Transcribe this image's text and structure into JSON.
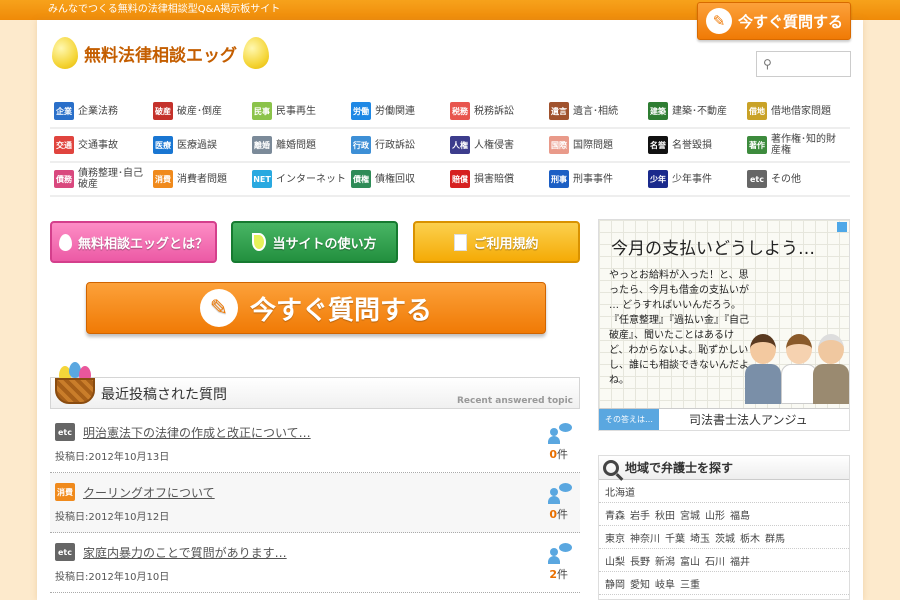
{
  "tagline": "みんなでつくる無料の法律相談型Q&A掲示板サイト",
  "header_button": "今すぐ質問する",
  "logo_text": "無料法律相談エッグ",
  "search": {
    "placeholder": ""
  },
  "categories": [
    [
      {
        "badge": "企業",
        "label": "企業法務",
        "color": "#2a6fc9"
      },
      {
        "badge": "破産",
        "label": "破産･倒産",
        "color": "#c4312b"
      },
      {
        "badge": "民事",
        "label": "民事再生",
        "color": "#8bc34a"
      },
      {
        "badge": "労働",
        "label": "労働関連",
        "color": "#1e88e5"
      },
      {
        "badge": "税務",
        "label": "税務訴訟",
        "color": "#e8554e"
      },
      {
        "badge": "遺言",
        "label": "遺言･相続",
        "color": "#a0522d"
      },
      {
        "badge": "建築",
        "label": "建築･不動産",
        "color": "#2e7d32"
      },
      {
        "badge": "借地",
        "label": "借地借家問題",
        "color": "#c9a227"
      }
    ],
    [
      {
        "badge": "交通",
        "label": "交通事故",
        "color": "#e0443e"
      },
      {
        "badge": "医療",
        "label": "医療過誤",
        "color": "#1976d2"
      },
      {
        "badge": "離婚",
        "label": "離婚問題",
        "color": "#7b8a99"
      },
      {
        "badge": "行政",
        "label": "行政訴訟",
        "color": "#3d8fd6"
      },
      {
        "badge": "人権",
        "label": "人権侵害",
        "color": "#3c3c8c"
      },
      {
        "badge": "国際",
        "label": "国際問題",
        "color": "#e99a8a"
      },
      {
        "badge": "名誉",
        "label": "名誉毀損",
        "color": "#111111"
      },
      {
        "badge": "著作",
        "label": "著作権･知的財産権",
        "color": "#3d8b3d"
      }
    ],
    [
      {
        "badge": "債務",
        "label": "債務整理･自己破産",
        "color": "#d9487e"
      },
      {
        "badge": "消費",
        "label": "消費者問題",
        "color": "#f08a1c"
      },
      {
        "badge": "NET",
        "label": "インターネット",
        "color": "#29a9e0"
      },
      {
        "badge": "債権",
        "label": "債権回収",
        "color": "#2e8b57"
      },
      {
        "badge": "賠償",
        "label": "損害賠償",
        "color": "#d62020"
      },
      {
        "badge": "刑事",
        "label": "刑事事件",
        "color": "#1c5fc4"
      },
      {
        "badge": "少年",
        "label": "少年事件",
        "color": "#1a2a8c"
      },
      {
        "badge": "etc",
        "label": "その他",
        "color": "#666666"
      }
    ]
  ],
  "nav_buttons": {
    "about": "無料相談エッグとは？",
    "howto": "当サイトの使い方",
    "terms": "ご利用規約"
  },
  "big_button": "今すぐ質問する",
  "recent": {
    "title": "最近投稿された質問",
    "subtitle": "Recent answered topic",
    "posts": [
      {
        "badge": "etc",
        "badge_color": "#666666",
        "title": "明治憲法下の法律の作成と改正について…",
        "date": "投稿日:2012年10月13日",
        "count": "0",
        "unit": "件"
      },
      {
        "badge": "消費",
        "badge_color": "#f08a1c",
        "title": "クーリングオフについて",
        "date": "投稿日:2012年10月12日",
        "count": "0",
        "unit": "件"
      },
      {
        "badge": "etc",
        "badge_color": "#666666",
        "title": "家庭内暴力のことで質問があります…",
        "date": "投稿日:2012年10月10日",
        "count": "2",
        "unit": "件"
      }
    ]
  },
  "ad": {
    "title": "今月の支払いどうしよう…",
    "body": "やっとお給料が入った！と、思ったら、今月も借金の支払いが … どうすればいいんだろう。『任意整理』『過払い金』『自己破産』、聞いたことはあるけど、わからないよ。恥ずかしいし、誰にも相談できないんだよね。",
    "footer_label": "その答えは…",
    "firm": "司法書士法人アンジュ"
  },
  "region": {
    "title": "地域で弁護士を探す",
    "rows": [
      [
        "北海道"
      ],
      [
        "青森",
        "岩手",
        "秋田",
        "宮城",
        "山形",
        "福島"
      ],
      [
        "東京",
        "神奈川",
        "千葉",
        "埼玉",
        "茨城",
        "栃木",
        "群馬"
      ],
      [
        "山梨",
        "長野",
        "新潟",
        "富山",
        "石川",
        "福井"
      ],
      [
        "静岡",
        "愛知",
        "岐阜",
        "三重"
      ]
    ]
  }
}
